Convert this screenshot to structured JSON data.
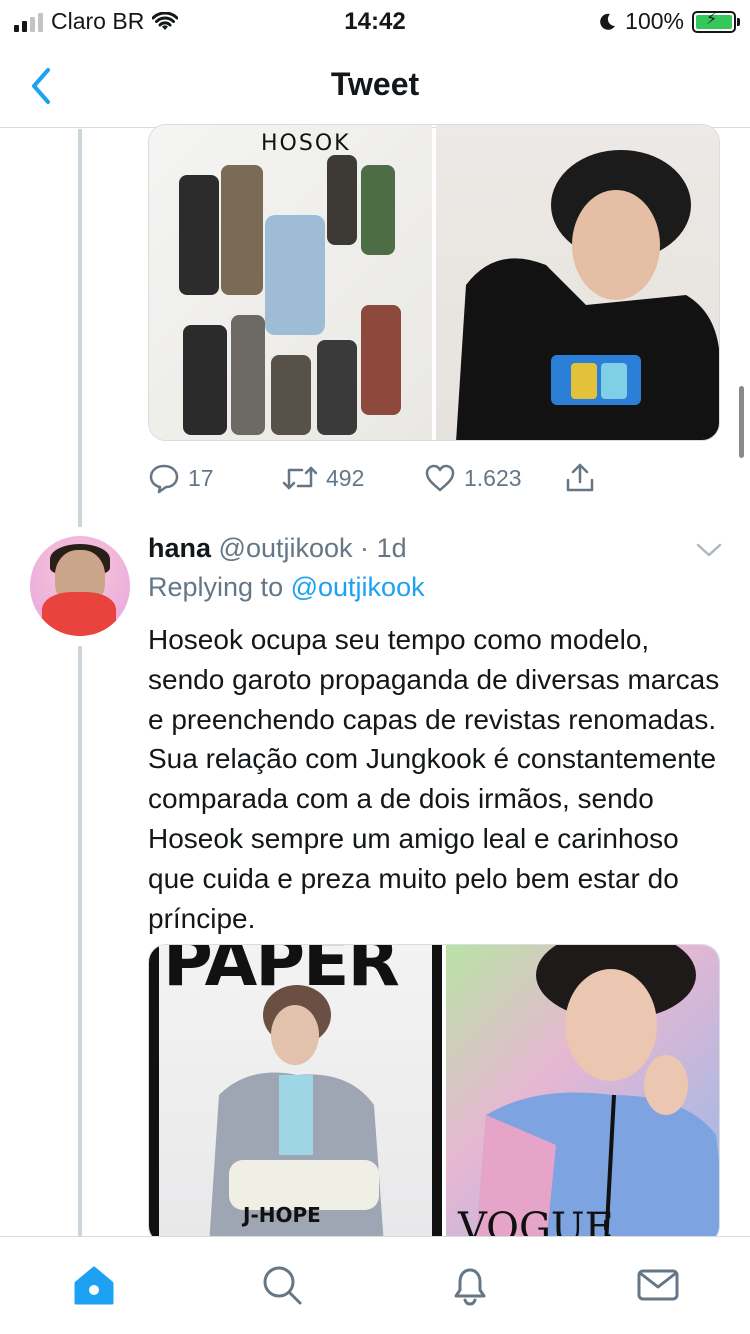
{
  "status_bar": {
    "carrier": "Claro BR",
    "time": "14:42",
    "battery": "100%"
  },
  "nav": {
    "title": "Tweet"
  },
  "tweet1": {
    "stats": {
      "replies": "17",
      "retweets": "492",
      "likes": "1.623"
    },
    "media": {
      "left_label": "HOSOK"
    }
  },
  "tweet2": {
    "name": "hana",
    "handle": "@outjikook",
    "time": "1d",
    "replying_prefix": "Replying to",
    "replying_mention": "@outjikook",
    "text": "Hoseok ocupa seu tempo como modelo, sendo garoto propaganda de diversas marcas e preenchendo capas de revistas renomadas. Sua relação com Jungkook é constantemente comparada com a de dois irmãos, sendo Hoseok sempre um amigo leal e carinhoso que cuida e preza muito pelo bem estar do príncipe.",
    "media": {
      "left_masthead": "PAPER",
      "left_caption": "J-HOPE",
      "right_masthead": "VOGUE"
    }
  },
  "colors": {
    "accent": "#1da1f2",
    "muted": "#657786",
    "thread_line": "#ccd6dd",
    "battery_green": "#34c759"
  },
  "icons": {
    "back": "chevron-left-icon",
    "reply": "speech-bubble-icon",
    "retweet": "retweet-icon",
    "like": "heart-icon",
    "share": "share-icon",
    "caret": "chevron-down-icon",
    "tabs": [
      "home-icon",
      "search-icon",
      "bell-icon",
      "mail-icon"
    ]
  }
}
